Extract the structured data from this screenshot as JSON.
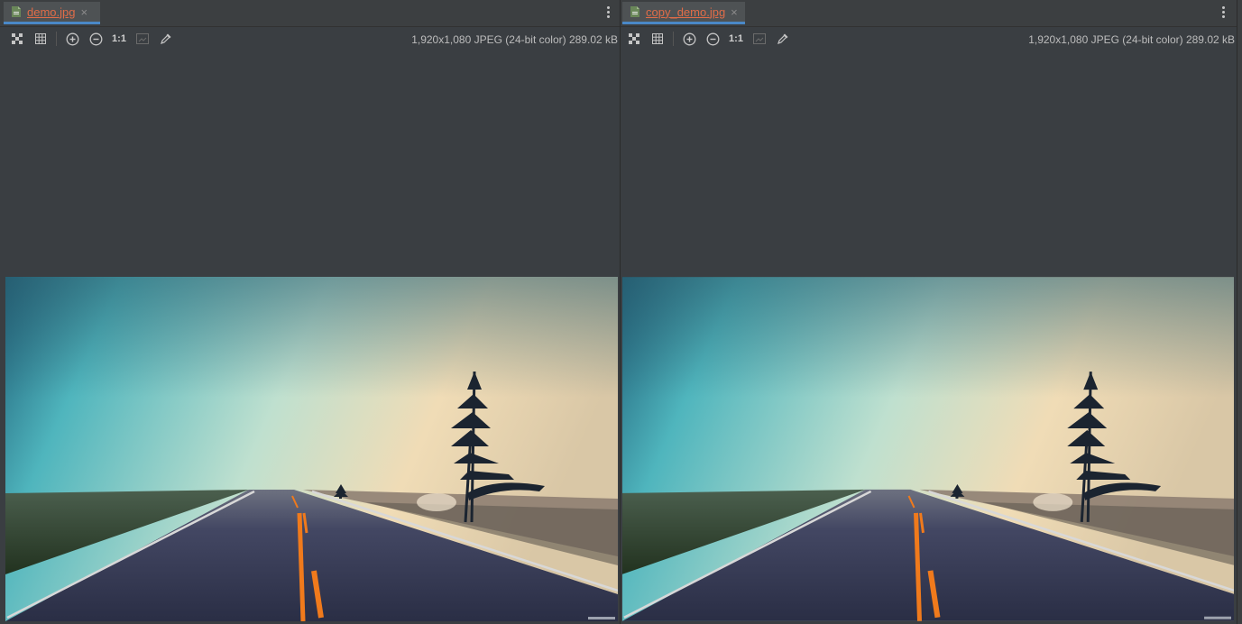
{
  "panes": [
    {
      "tab": {
        "label": "demo.jpg",
        "close": "×",
        "icon": "image-file-icon"
      },
      "toolbar": {
        "actual_size": "1:1"
      },
      "info": "1,920x1,080 JPEG (24-bit color) 289.02 kB"
    },
    {
      "tab": {
        "label": "copy_demo.jpg",
        "close": "×",
        "icon": "image-file-icon"
      },
      "toolbar": {
        "actual_size": "1:1"
      },
      "info": "1,920x1,080 JPEG (24-bit color) 289.02 kB"
    }
  ],
  "colors": {
    "tab_label": "#e06c48",
    "editor_bg": "#3a3e42",
    "sky_left": "#4fb5bd",
    "sky_right": "#f0dcb6",
    "road": "#2a2e45",
    "center_line": "#f07a1c"
  }
}
